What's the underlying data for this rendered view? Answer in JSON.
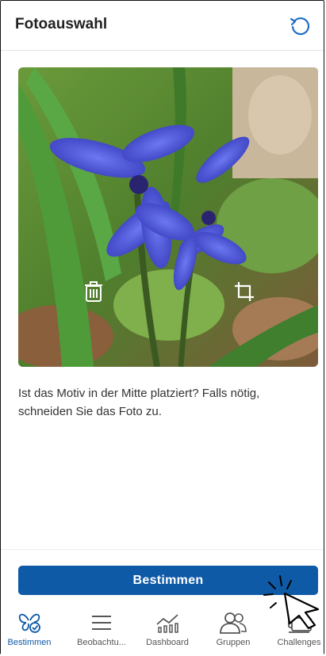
{
  "header": {
    "title": "Fotoauswahl",
    "reload_icon": "refresh-icon"
  },
  "photo": {
    "subject": "",
    "delete_icon": "trash-icon",
    "crop_icon": "crop-icon"
  },
  "hint_text": "Ist das Motiv in der Mitte platziert? Falls nötig, schneiden Sie das Foto zu.",
  "primary_button": {
    "label": "Bestimmen"
  },
  "nav": {
    "items": [
      {
        "label": "Bestimmen",
        "icon": "butterfly-check-icon",
        "active": true
      },
      {
        "label": "Beobachtu...",
        "icon": "list-icon",
        "active": false
      },
      {
        "label": "Dashboard",
        "icon": "chart-icon",
        "active": false
      },
      {
        "label": "Gruppen",
        "icon": "group-icon",
        "active": false
      },
      {
        "label": "Challenges",
        "icon": "challenge-icon",
        "active": false
      }
    ]
  },
  "colors": {
    "primary": "#0f5aa7",
    "flower": "#4b55d6",
    "leaf": "#5f8f3a"
  }
}
